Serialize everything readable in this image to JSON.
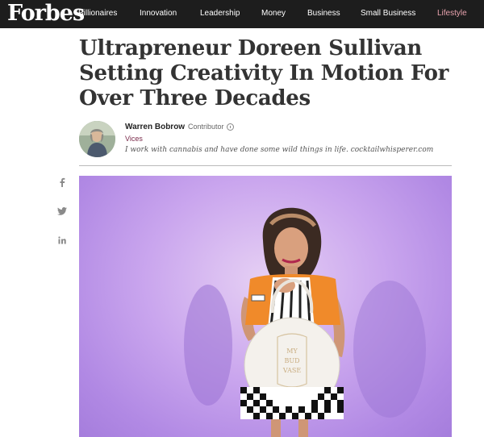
{
  "site": {
    "logo": "Forbes"
  },
  "nav": {
    "items": [
      {
        "label": "Billionaires"
      },
      {
        "label": "Innovation"
      },
      {
        "label": "Leadership"
      },
      {
        "label": "Money"
      },
      {
        "label": "Business"
      },
      {
        "label": "Small Business"
      },
      {
        "label": "Lifestyle"
      }
    ]
  },
  "article": {
    "headline": "Ultrapreneur Doreen Sullivan Setting Creativity In Motion For Over Three Decades",
    "author": {
      "name": "Warren Bobrow",
      "role": "Contributor",
      "section": "Vices",
      "bio": "I work with cannabis and have done some wild things in life. cocktailwhisperer.com"
    },
    "image": {
      "product_text": [
        "MY",
        "BUD",
        "VASE"
      ]
    }
  },
  "colors": {
    "nav_bg": "#1d1d1d",
    "nav_active": "#e8a3ae",
    "section_link": "#7a2a4a",
    "hero_bg": "#b189e4"
  },
  "share": {
    "icons": [
      "facebook-icon",
      "twitter-icon",
      "linkedin-icon"
    ]
  }
}
